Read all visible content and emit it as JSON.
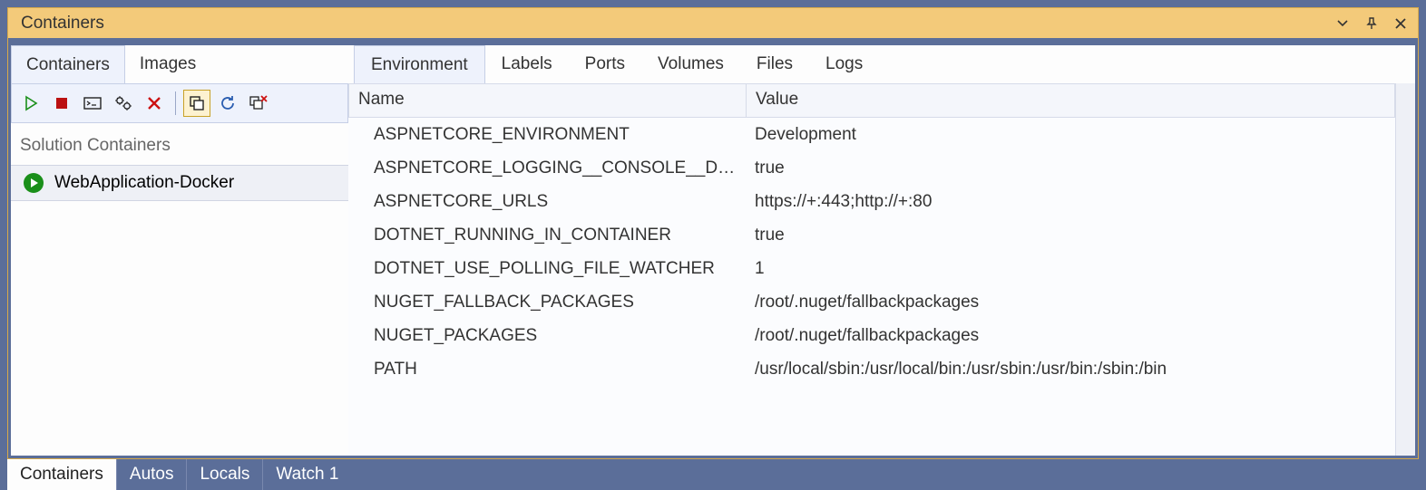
{
  "window": {
    "title": "Containers"
  },
  "leftTabs": {
    "containers": "Containers",
    "images": "Images"
  },
  "sidebar": {
    "groupHeader": "Solution Containers",
    "items": [
      {
        "label": "WebApplication-Docker"
      }
    ]
  },
  "rightTabs": {
    "environment": "Environment",
    "labels": "Labels",
    "ports": "Ports",
    "volumes": "Volumes",
    "files": "Files",
    "logs": "Logs"
  },
  "columns": {
    "name": "Name",
    "value": "Value"
  },
  "env": [
    {
      "name": "ASPNETCORE_ENVIRONMENT",
      "value": "Development"
    },
    {
      "name": "ASPNETCORE_LOGGING__CONSOLE__DISA…",
      "value": "true"
    },
    {
      "name": "ASPNETCORE_URLS",
      "value": "https://+:443;http://+:80"
    },
    {
      "name": "DOTNET_RUNNING_IN_CONTAINER",
      "value": "true"
    },
    {
      "name": "DOTNET_USE_POLLING_FILE_WATCHER",
      "value": "1"
    },
    {
      "name": "NUGET_FALLBACK_PACKAGES",
      "value": "/root/.nuget/fallbackpackages"
    },
    {
      "name": "NUGET_PACKAGES",
      "value": "/root/.nuget/fallbackpackages"
    },
    {
      "name": "PATH",
      "value": "/usr/local/sbin:/usr/local/bin:/usr/sbin:/usr/bin:/sbin:/bin"
    }
  ],
  "dock": {
    "containers": "Containers",
    "autos": "Autos",
    "locals": "Locals",
    "watch1": "Watch 1"
  }
}
